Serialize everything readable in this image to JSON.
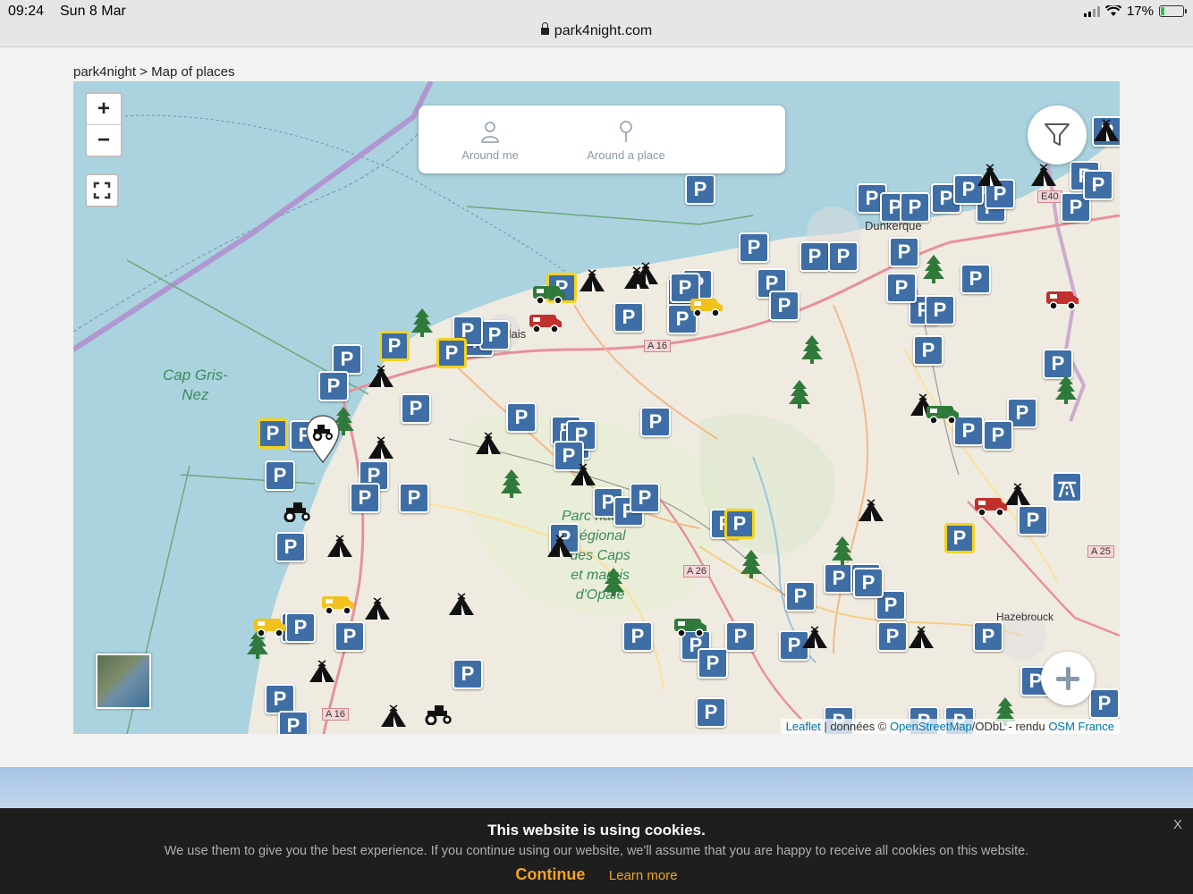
{
  "status_bar": {
    "time": "09:24",
    "date": "Sun 8 Mar",
    "url": "park4night.com",
    "battery": "17%",
    "battery_level": 0.17
  },
  "breadcrumb": "park4night > Map of places",
  "map": {
    "search": {
      "around_me": "Around me",
      "around_place": "Around a place"
    },
    "labels": {
      "cap_gris_nez_1": "Cap Gris-",
      "cap_gris_nez_2": "Nez",
      "parc_1": "Parc naturel",
      "parc_2": "régional",
      "parc_3": "des Caps",
      "parc_4": "et marais",
      "parc_5": "d'Opale",
      "hazebrouck": "Hazebrouck",
      "dunkerque": "Dunkerque",
      "road_a16_1": "A 16",
      "road_a16_2": "A 16",
      "road_a26": "A 26",
      "road_a25": "A 25",
      "road_e40": "E40",
      "calais": "Calais"
    },
    "attribution": {
      "leaflet": "Leaflet",
      "donnees": " | données © ",
      "osm": "OpenStreetMap",
      "odbl": "/ODbL - rendu ",
      "osmfr": "OSM France"
    }
  },
  "cookie": {
    "title": "This website is using cookies.",
    "text": "We use them to give you the best experience. If you continue using our website, we'll assume that you are happy to receive all cookies on this website.",
    "continue": "Continue",
    "learn_more": "Learn more",
    "close": "X"
  }
}
